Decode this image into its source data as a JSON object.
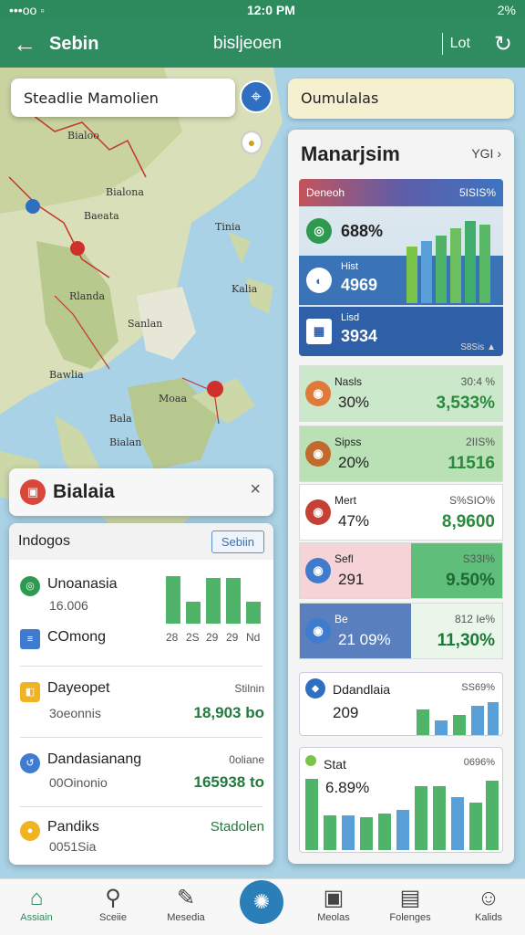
{
  "status": {
    "left": "•••oo ◦",
    "time": "12:0 PM",
    "right": "2%"
  },
  "appbar": {
    "back_icon": "←",
    "title": "Sebin",
    "subtitle": "bisljeoen",
    "right_label": "Lot"
  },
  "map": {
    "labels": [
      "Bialoo",
      "Bialona",
      "Baeata",
      "Rlanda",
      "Tinia",
      "Kalia",
      "Sanlan",
      "Bawlia",
      "Moaa",
      "Bala",
      "Bialan"
    ]
  },
  "search": {
    "left_value": "Steadlie Mamolien",
    "right_value": "Oumulalas"
  },
  "popup": {
    "title": "Bialaia",
    "close": "×"
  },
  "list": {
    "header": "Indogos",
    "button": "Sebiin",
    "items": [
      {
        "title": "Unoanasia",
        "sub": "16.006",
        "ra": "",
        "rb": ""
      },
      {
        "title": "COmong",
        "sub": "",
        "ra": "",
        "rb": ""
      },
      {
        "title": "Dayeopet",
        "sub": "3oeonnis",
        "ra": "Stilnin",
        "rb": "18,903 bo"
      },
      {
        "title": "Dandasianang",
        "sub": "00Oinonio",
        "ra": "0oliane",
        "rb": "165938 to"
      },
      {
        "title": "Pandiks",
        "sub": "0051Sia",
        "ra": "",
        "rb": "Stadolen"
      }
    ],
    "chart_ticks": [
      "28",
      "2S",
      "29",
      "29",
      "Nd"
    ]
  },
  "panel": {
    "title": "Manarjsim",
    "more": "YGI ›",
    "block1": {
      "header_left": "Deneoh",
      "header_right": "5ISIS%",
      "rows": [
        {
          "label": "",
          "value": "688%"
        },
        {
          "label": "Hist",
          "value": "4969"
        },
        {
          "label": "Lisd",
          "value": "3934"
        }
      ],
      "foot": "S8Sis ▲"
    },
    "metrics": [
      {
        "label": "Nasls",
        "value": "30%",
        "rlabel": "30:4 %",
        "rvalue": "3,533%",
        "bg": "#cbe8cb",
        "color": "#2a8a3e",
        "ic": "#e07a3a"
      },
      {
        "label": "Sipss",
        "value": "20%",
        "rlabel": "2IIS%",
        "rvalue": "11516",
        "bg": "#b9e1b5",
        "color": "#2a8a3e",
        "ic": "#c26a2e"
      },
      {
        "label": "Mert",
        "value": "47%",
        "rlabel": "S%SIO%",
        "rvalue": "8,9600",
        "bg": "#ffffff",
        "color": "#2a8a3e",
        "ic": "#c64036"
      },
      {
        "label": "Sefl",
        "value": "291",
        "rlabel": "S33I%",
        "rvalue": "9.50%",
        "bg": "#f6d3d6",
        "color": "#1d6a34",
        "ic": "#3f7ccf"
      },
      {
        "label": "Be",
        "value": "21 09%",
        "rlabel": "812 Ie%",
        "rvalue": "11,30%",
        "bg": "#5a7fbf",
        "color": "#1d7a3a",
        "ic": "#3f7ccf"
      }
    ],
    "card1": {
      "title": "Ddandlaia",
      "value": "209",
      "rlabel": "SS69%"
    },
    "card2": {
      "title": "Stat",
      "value": "6.89%",
      "rlabel": "0696%"
    }
  },
  "nav": [
    {
      "icon": "⌂",
      "label": "Assiain"
    },
    {
      "icon": "⚲",
      "label": "Sceiie"
    },
    {
      "icon": "✎",
      "label": "Mesedia"
    },
    {
      "icon": "▣",
      "label": "Meolas"
    },
    {
      "icon": "▤",
      "label": "Folenges"
    },
    {
      "icon": "☺",
      "label": "Kalids"
    }
  ],
  "colors": {
    "brand": "#2e8c60",
    "accent": "#2a7fb8"
  }
}
